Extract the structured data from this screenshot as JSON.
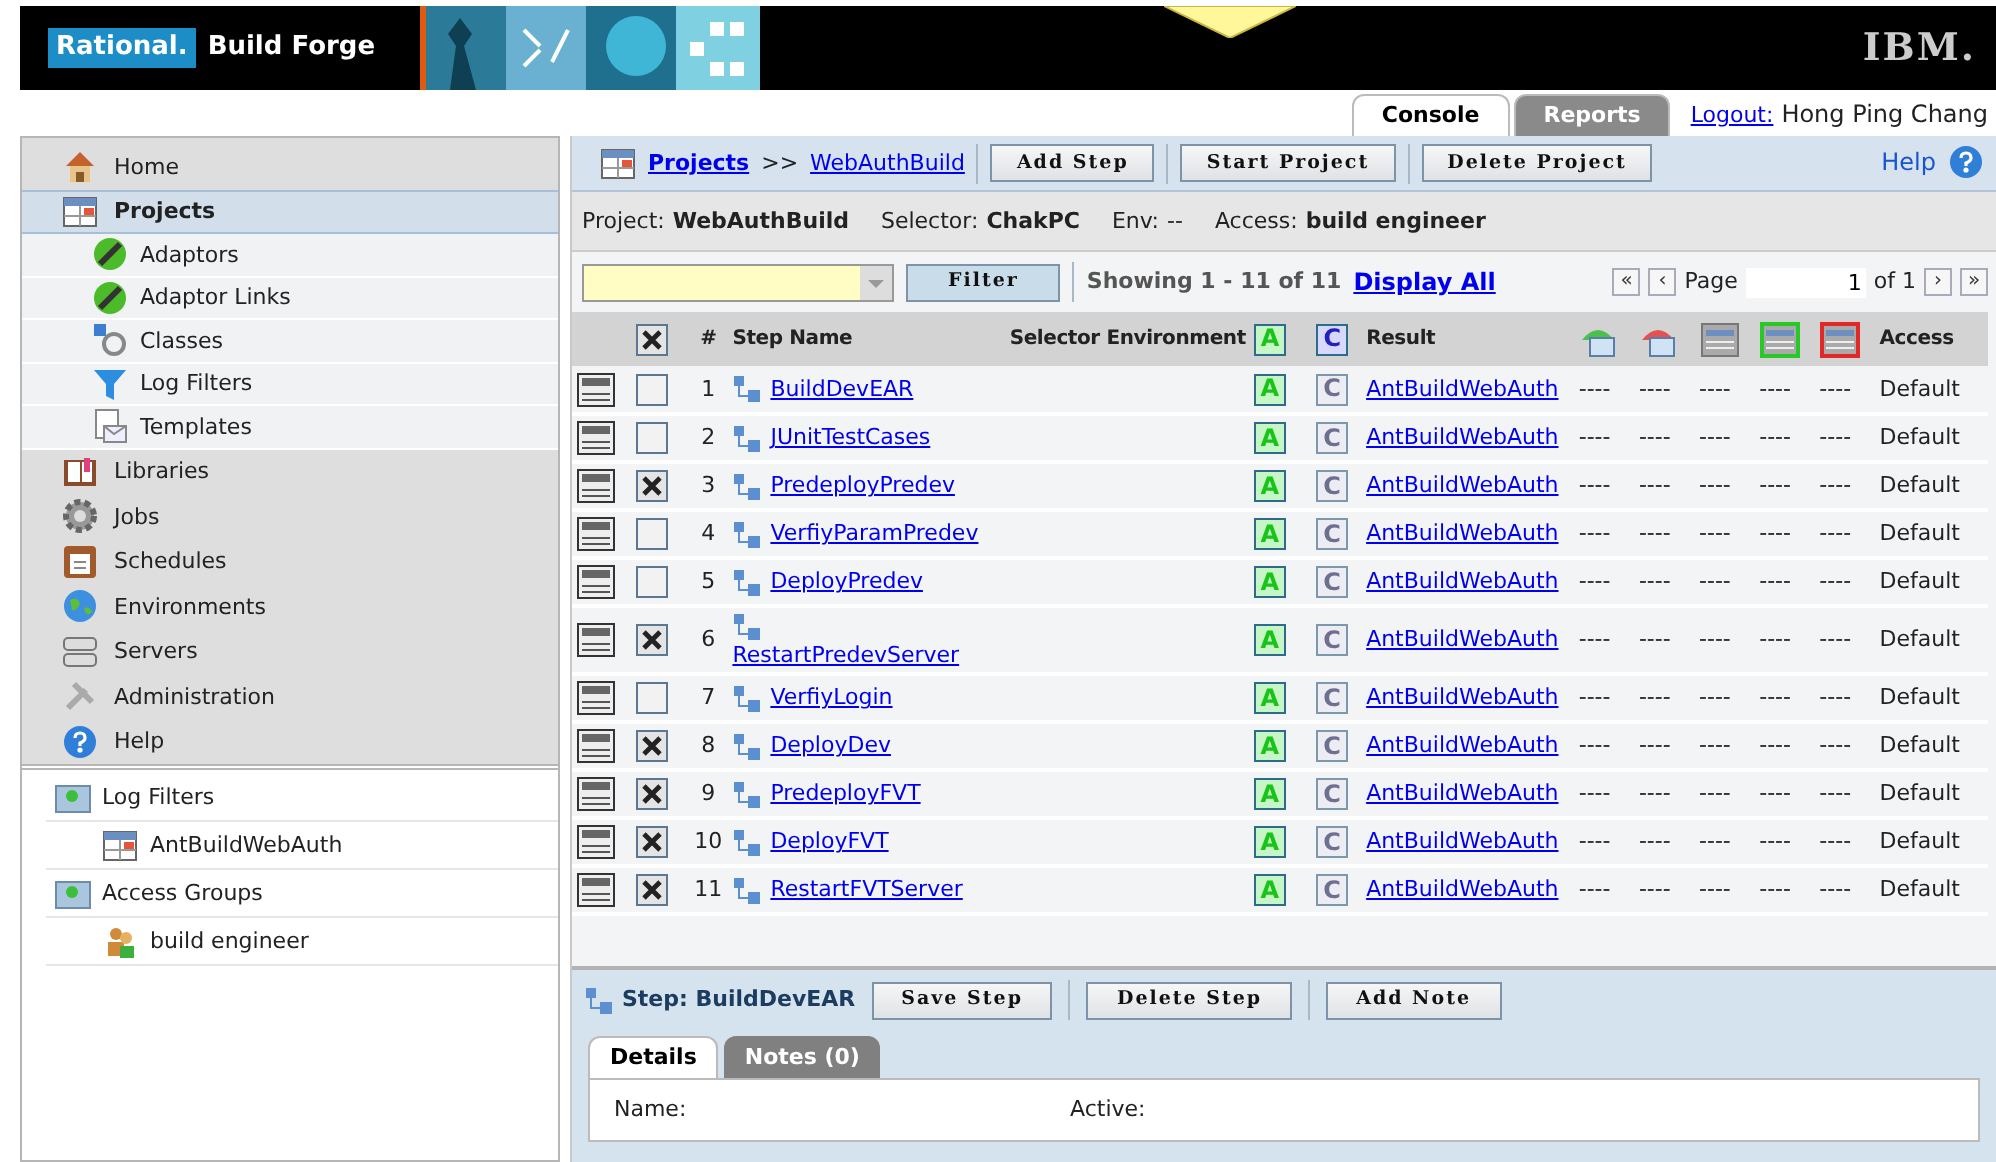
{
  "banner": {
    "brand": "Rational.",
    "product": "Build Forge",
    "vendor": "IBM."
  },
  "tabs": [
    {
      "label": "Console",
      "selected": true
    },
    {
      "label": "Reports",
      "selected": false
    }
  ],
  "logout": {
    "link": "Logout:",
    "user": "Hong Ping Chang"
  },
  "sidebar": {
    "items": [
      {
        "label": "Home",
        "selected": false
      },
      {
        "label": "Projects",
        "selected": true,
        "children": [
          {
            "label": "Adaptors"
          },
          {
            "label": "Adaptor Links"
          },
          {
            "label": "Classes"
          },
          {
            "label": "Log Filters"
          },
          {
            "label": "Templates"
          }
        ]
      },
      {
        "label": "Libraries",
        "selected": false
      },
      {
        "label": "Jobs",
        "selected": false
      },
      {
        "label": "Schedules",
        "selected": false
      },
      {
        "label": "Environments",
        "selected": false
      },
      {
        "label": "Servers",
        "selected": false
      },
      {
        "label": "Administration",
        "selected": false
      },
      {
        "label": "Help",
        "selected": false
      }
    ],
    "tree": [
      {
        "label": "Log Filters",
        "children": [
          {
            "label": "AntBuildWebAuth"
          }
        ]
      },
      {
        "label": "Access Groups",
        "children": [
          {
            "label": "build engineer"
          }
        ]
      }
    ]
  },
  "toolbar": {
    "breadcrumb": [
      "Projects",
      "WebAuthBuild"
    ],
    "separator": ">>",
    "buttons": [
      "Add Step",
      "Start Project",
      "Delete Project"
    ],
    "help": "Help"
  },
  "project_info": [
    {
      "label": "Project:",
      "value": "WebAuthBuild",
      "emphasis": true
    },
    {
      "label": "Selector:",
      "value": "ChakPC",
      "emphasis": true
    },
    {
      "label": "Env:",
      "value": "--",
      "emphasis": false
    },
    {
      "label": "Access:",
      "value": "build engineer",
      "emphasis": true
    }
  ],
  "filter": {
    "button": "Filter",
    "showing": "Showing 1 - 11 of 11",
    "display_all": "Display All",
    "pager": {
      "first": "«",
      "prev": "‹",
      "page_label": "Page",
      "page": "1",
      "of": "of 1",
      "next": "›",
      "last": "»"
    }
  },
  "table": {
    "all_checked": true,
    "columns": {
      "number": "#",
      "step_name": "Step Name",
      "selector_environment": "Selector Environment",
      "active": "A",
      "conditional": "C",
      "result": "Result",
      "access": "Access"
    },
    "rows": [
      {
        "number": "1",
        "name": "BuildDevEAR",
        "checked": false,
        "wrapped": false,
        "active": "A",
        "conditional": "C",
        "conditional_on": false,
        "result": "AntBuildWebAuth",
        "dashes": [
          "----",
          "----",
          "----",
          "----",
          "----"
        ],
        "access": "Default"
      },
      {
        "number": "2",
        "name": "JUnitTestCases",
        "checked": false,
        "wrapped": false,
        "active": "A",
        "conditional": "C",
        "conditional_on": false,
        "result": "AntBuildWebAuth",
        "dashes": [
          "----",
          "----",
          "----",
          "----",
          "----"
        ],
        "access": "Default"
      },
      {
        "number": "3",
        "name": "PredeployPredev",
        "checked": true,
        "wrapped": false,
        "active": "A",
        "conditional": "C",
        "conditional_on": false,
        "result": "AntBuildWebAuth",
        "dashes": [
          "----",
          "----",
          "----",
          "----",
          "----"
        ],
        "access": "Default"
      },
      {
        "number": "4",
        "name": "VerfiyParamPredev",
        "checked": false,
        "wrapped": false,
        "active": "A",
        "conditional": "C",
        "conditional_on": false,
        "result": "AntBuildWebAuth",
        "dashes": [
          "----",
          "----",
          "----",
          "----",
          "----"
        ],
        "access": "Default"
      },
      {
        "number": "5",
        "name": "DeployPredev",
        "checked": false,
        "wrapped": false,
        "active": "A",
        "conditional": "C",
        "conditional_on": false,
        "result": "AntBuildWebAuth",
        "dashes": [
          "----",
          "----",
          "----",
          "----",
          "----"
        ],
        "access": "Default"
      },
      {
        "number": "6",
        "name": "RestartPredevServer",
        "checked": true,
        "wrapped": true,
        "active": "A",
        "conditional": "C",
        "conditional_on": false,
        "result": "AntBuildWebAuth",
        "dashes": [
          "----",
          "----",
          "----",
          "----",
          "----"
        ],
        "access": "Default"
      },
      {
        "number": "7",
        "name": "VerfiyLogin",
        "checked": false,
        "wrapped": false,
        "active": "A",
        "conditional": "C",
        "conditional_on": false,
        "result": "AntBuildWebAuth",
        "dashes": [
          "----",
          "----",
          "----",
          "----",
          "----"
        ],
        "access": "Default"
      },
      {
        "number": "8",
        "name": "DeployDev",
        "checked": true,
        "wrapped": false,
        "active": "A",
        "conditional": "C",
        "conditional_on": false,
        "result": "AntBuildWebAuth",
        "dashes": [
          "----",
          "----",
          "----",
          "----",
          "----"
        ],
        "access": "Default"
      },
      {
        "number": "9",
        "name": "PredeployFVT",
        "checked": true,
        "wrapped": false,
        "active": "A",
        "conditional": "C",
        "conditional_on": false,
        "result": "AntBuildWebAuth",
        "dashes": [
          "----",
          "----",
          "----",
          "----",
          "----"
        ],
        "access": "Default"
      },
      {
        "number": "10",
        "name": "DeployFVT",
        "checked": true,
        "wrapped": false,
        "active": "A",
        "conditional": "C",
        "conditional_on": false,
        "result": "AntBuildWebAuth",
        "dashes": [
          "----",
          "----",
          "----",
          "----",
          "----"
        ],
        "access": "Default"
      },
      {
        "number": "11",
        "name": "RestartFVTServer",
        "checked": true,
        "wrapped": false,
        "active": "A",
        "conditional": "C",
        "conditional_on": false,
        "result": "AntBuildWebAuth",
        "dashes": [
          "----",
          "----",
          "----",
          "----",
          "----"
        ],
        "access": "Default"
      }
    ]
  },
  "step_panel": {
    "title": "Step: BuildDevEAR",
    "buttons": [
      "Save Step",
      "Delete Step",
      "Add Note"
    ],
    "tabs": [
      {
        "label": "Details",
        "selected": true
      },
      {
        "label": "Notes (0)",
        "selected": false
      }
    ],
    "fields": [
      {
        "label": "Name:"
      },
      {
        "label": "Active:"
      }
    ]
  }
}
